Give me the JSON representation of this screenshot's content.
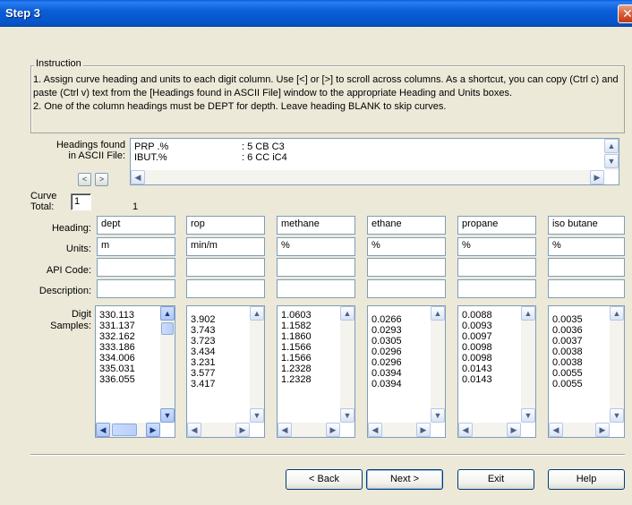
{
  "window": {
    "title": "Step 3",
    "close_glyph": "✕"
  },
  "instruction": {
    "legend": "Instruction",
    "line1": "1. Assign curve heading and units to each digit column. Use [<] or [>] to scroll across columns. As a shortcut, you can copy (Ctrl c) and paste (Ctrl v) text from the [Headings found in ASCII File] window to the appropriate Heading and Units boxes.",
    "line2": "2. One of the column headings must be DEPT for depth. Leave heading BLANK to skip curves."
  },
  "headings_found": {
    "label_line1": "Headings found",
    "label_line2": "in ASCII File:",
    "lines": [
      {
        "name": "PRP .%",
        "desc": ": 5 CB C3"
      },
      {
        "name": "IBUT.%",
        "desc": ": 6 CC iC4"
      }
    ]
  },
  "nav": {
    "prev": "<",
    "next": ">"
  },
  "curve_total": {
    "label_line1": "Curve",
    "label_line2": "Total:",
    "value": "1"
  },
  "column_index": "1",
  "row_labels": {
    "heading": "Heading:",
    "units": "Units:",
    "api": "API Code:",
    "description": "Description:",
    "samples_line1": "Digit",
    "samples_line2": "Samples:"
  },
  "columns": [
    {
      "heading": "dept",
      "units": "m",
      "api": "",
      "description": "",
      "samples": [
        "330.113",
        "331.137",
        "332.162",
        "333.186",
        "334.006",
        "335.031",
        "336.055"
      ]
    },
    {
      "heading": "rop",
      "units": "min/m",
      "api": "",
      "description": "",
      "samples": [
        "3.902",
        "3.743",
        "3.723",
        "3.434",
        "3.231",
        "3.577",
        "3.417"
      ]
    },
    {
      "heading": "methane",
      "units": "%",
      "api": "",
      "description": "",
      "samples": [
        "1.0603",
        "1.1582",
        "1.1860",
        "1.1566",
        "1.1566",
        "1.2328",
        "1.2328"
      ]
    },
    {
      "heading": "ethane",
      "units": "%",
      "api": "",
      "description": "",
      "samples": [
        "0.0266",
        "0.0293",
        "0.0305",
        "0.0296",
        "0.0296",
        "0.0394",
        "0.0394"
      ]
    },
    {
      "heading": "propane",
      "units": "%",
      "api": "",
      "description": "",
      "samples": [
        "0.0088",
        "0.0093",
        "0.0097",
        "0.0098",
        "0.0098",
        "0.0143",
        "0.0143"
      ]
    },
    {
      "heading": "iso butane",
      "units": "%",
      "api": "",
      "description": "",
      "samples": [
        "0.0035",
        "0.0036",
        "0.0037",
        "0.0038",
        "0.0038",
        "0.0055",
        "0.0055"
      ]
    }
  ],
  "buttons": {
    "back": "< Back",
    "next": "Next >",
    "exit": "Exit",
    "help": "Help"
  },
  "colors": {
    "title_bar": "#0a5fd8",
    "dialog_bg": "#ece9d8",
    "close": "#d55a32"
  }
}
